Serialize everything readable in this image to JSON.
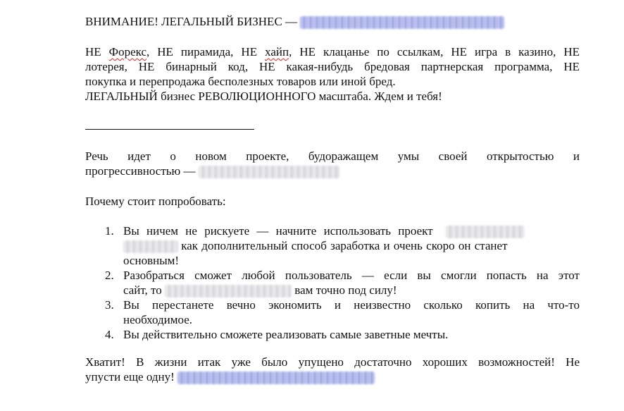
{
  "heading": {
    "text": "ВНИМАНИЕ! ЛЕГАЛЬНЫЙ БИЗНЕС —"
  },
  "intro": {
    "line1_pre": "НЕ ",
    "line1_forex": "Форекс",
    "line1_mid": ", НЕ пирамида, НЕ ",
    "line1_hype": "хайп",
    "line1_post": ", НЕ клацанье по ссылкам, НЕ игра в казино, НЕ",
    "line2": "лотерея, НЕ бинарный код, НЕ какая-нибудь бредовая партнерская программа, НЕ",
    "line3": "покупка и перепродажа бесполезных товаров или иной бред.",
    "line4": "ЛЕГАЛЬНЫЙ бизнес РЕВОЛЮЦИОННОГО масштаба.  Ждем и тебя!"
  },
  "speech": {
    "line1": "Речь идет о новом проекте, будоражащем умы своей открытостью и",
    "line2": "прогрессивностью —"
  },
  "why": {
    "text": "Почему стоит попробовать:"
  },
  "list": [
    {
      "num": "1.",
      "line1": "Вы ничем не рискуете — начните использовать проект",
      "line2": "как дополнительный способ заработка и очень скоро он станет",
      "line3": "основным!"
    },
    {
      "num": "2.",
      "line1": "Разобраться сможет любой пользователь — если вы смогли попасть на этот",
      "line2_pre": "сайт, то",
      "line2_post": "вам точно под силу!"
    },
    {
      "num": "3.",
      "line1": "Вы перестанете вечно экономить и неизвестно сколько копить на что-то",
      "line2": "необходимое."
    },
    {
      "num": "4.",
      "line1": "Вы действительно сможете реализовать самые заветные мечты."
    }
  ],
  "closing": {
    "line1": "Хватит! В жизни итак уже было упущено достаточно хороших возможностей! Не",
    "line2": "упусти еще одну!"
  }
}
